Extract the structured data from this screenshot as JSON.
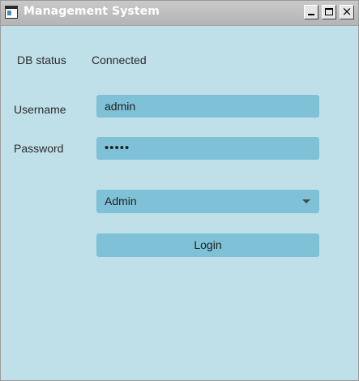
{
  "window": {
    "title": "Management System",
    "icon": "app-window-icon",
    "controls": {
      "minimize_icon": "minimize-icon",
      "maximize_icon": "maximize-icon",
      "close_icon": "close-icon",
      "close_glyph": "×"
    }
  },
  "db_status": {
    "label": "DB status",
    "value": "Connected"
  },
  "username": {
    "label": "Username",
    "value": "admin"
  },
  "password": {
    "label": "Password",
    "value": "•••••"
  },
  "role_select": {
    "selected": "Admin",
    "icon": "chevron-down-icon"
  },
  "login_button": {
    "label": "Login"
  },
  "colors": {
    "background": "#bfe0e8",
    "control": "#7fc1d7",
    "titlebar": "#b4b4b4"
  }
}
